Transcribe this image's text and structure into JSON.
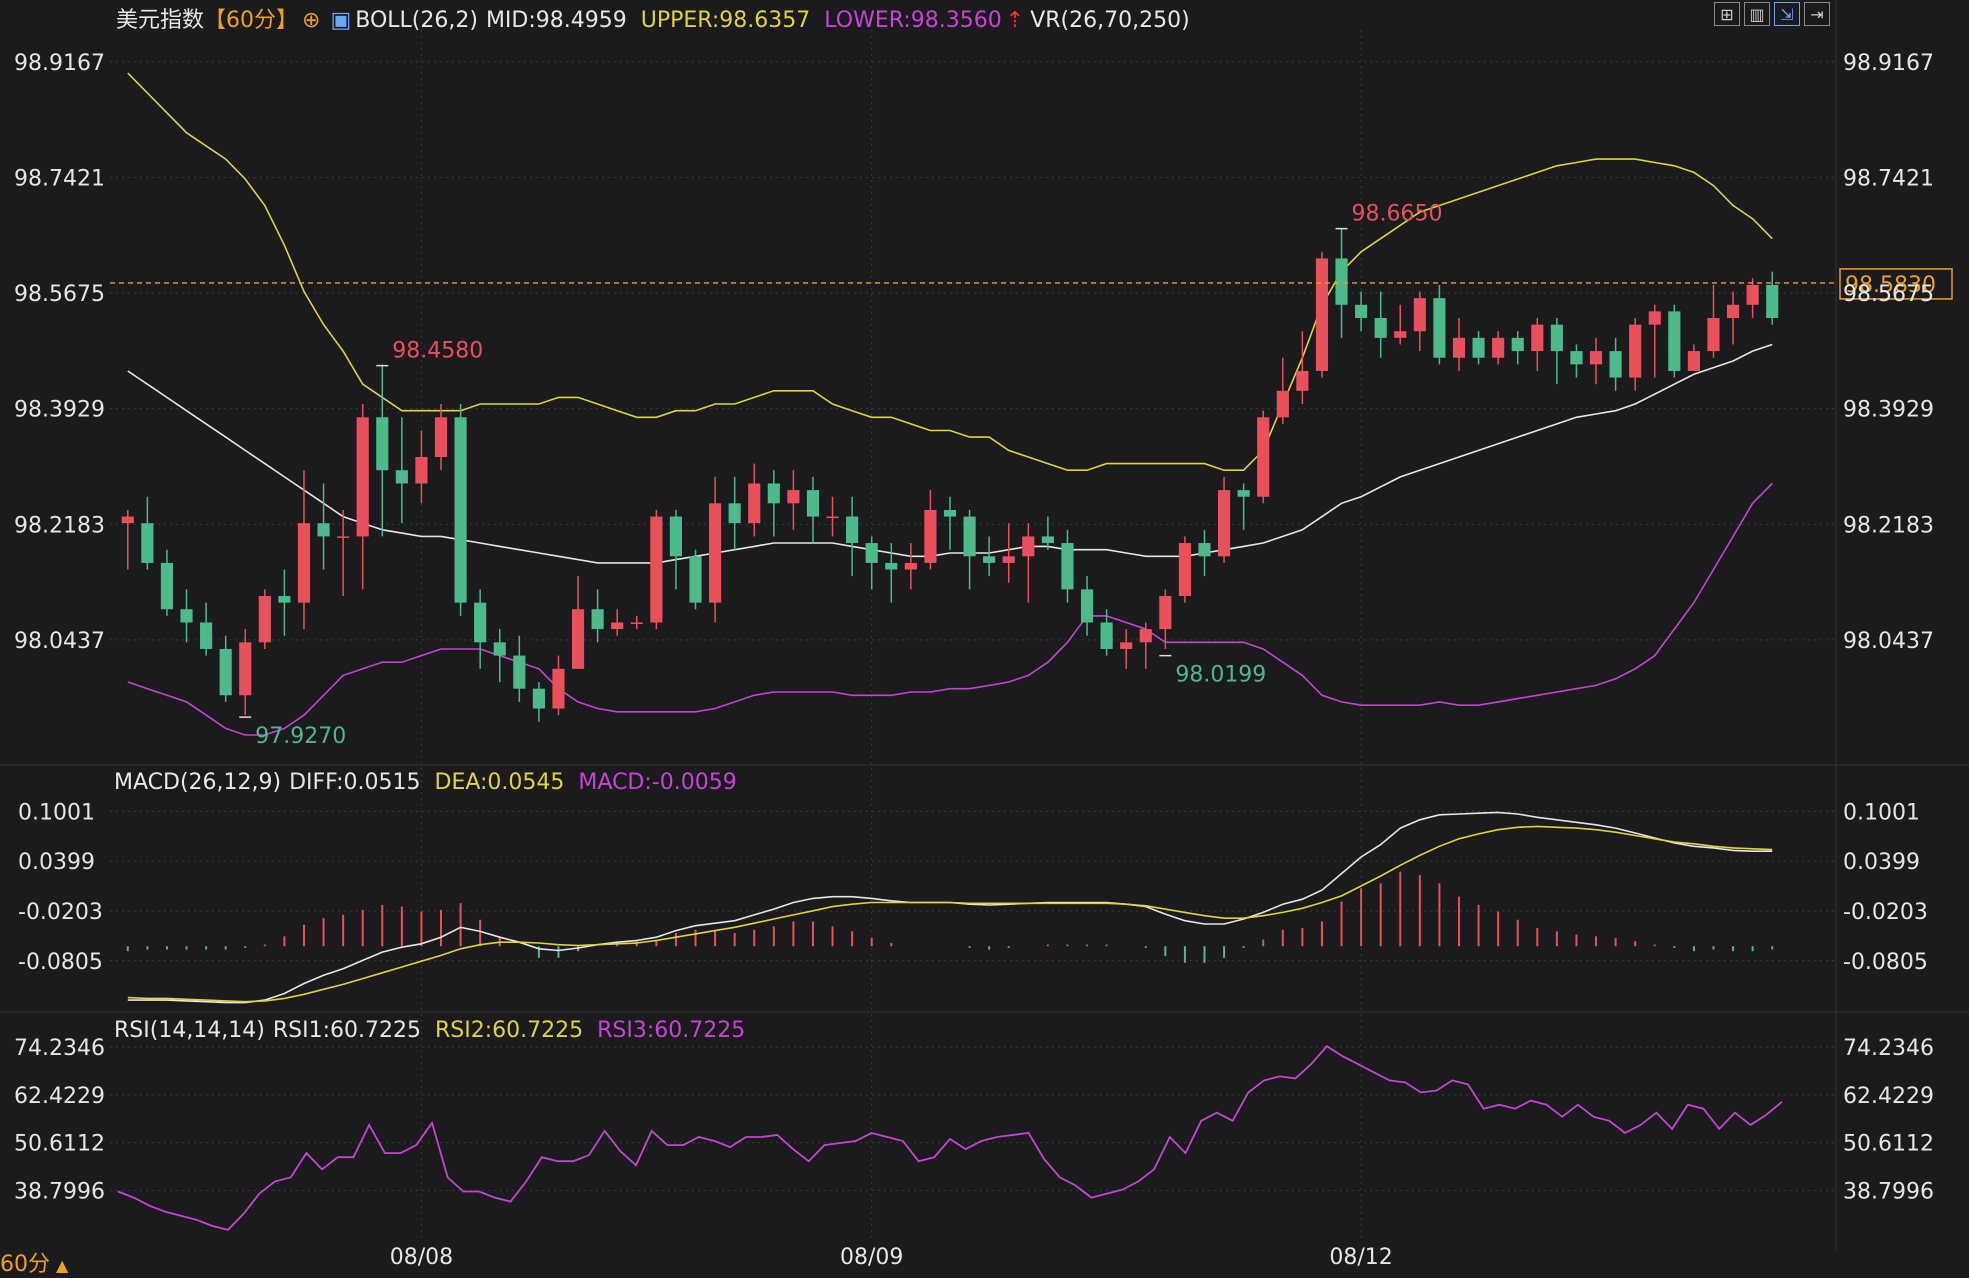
{
  "header": {
    "symbol": "美元指数",
    "period_tag": "【60分】",
    "boll_label": "BOLL(26,2)",
    "mid": "MID:98.4959",
    "upper": "UPPER:98.6357",
    "lower": "LOWER:98.3560",
    "vr_label": "VR(26,70,250)"
  },
  "macd_header": {
    "label": "MACD(26,12,9)",
    "diff": "DIFF:0.0515",
    "dea": "DEA:0.0545",
    "macd": "MACD:-0.0059"
  },
  "rsi_header": {
    "label": "RSI(14,14,14)",
    "rsi1": "RSI1:60.7225",
    "rsi2": "RSI2:60.7225",
    "rsi3": "RSI3:60.7225"
  },
  "period_footer": "60分",
  "colors": {
    "bg": "#1b1b1d",
    "up": "#e8515c",
    "down": "#4eb98a",
    "upper": "#e0d43a",
    "lower": "#c843d6",
    "mid": "#e6e6e6",
    "accent": "#f0a020",
    "grid": "#3a3a3a"
  },
  "chart_data": {
    "type": "candlestick",
    "price_axis_ticks": [
      98.9167,
      98.7421,
      98.5675,
      98.3929,
      98.2183,
      98.0437
    ],
    "price_axis_labels": [
      "98.9167",
      "98.7421",
      "98.5675",
      "98.3929",
      "98.2183",
      "98.0437"
    ],
    "ylim": [
      97.9,
      98.95
    ],
    "last_price": "98.5830",
    "last_price_value": 98.583,
    "high_annotations": [
      {
        "label": "98.4580",
        "value": 98.458,
        "index": 13
      },
      {
        "label": "98.6650",
        "value": 98.665,
        "index": 62
      }
    ],
    "low_annotations": [
      {
        "label": "97.9270",
        "value": 97.927,
        "index": 6
      },
      {
        "label": "98.0199",
        "value": 98.0199,
        "index": 53
      }
    ],
    "date_labels": [
      {
        "label": "08/08",
        "index": 15
      },
      {
        "label": "08/09",
        "index": 38
      },
      {
        "label": "08/12",
        "index": 63
      }
    ],
    "candles": [
      [
        98.22,
        98.23,
        98.15,
        98.24
      ],
      [
        98.22,
        98.16,
        98.15,
        98.26
      ],
      [
        98.16,
        98.09,
        98.08,
        98.18
      ],
      [
        98.09,
        98.07,
        98.04,
        98.12
      ],
      [
        98.07,
        98.03,
        98.02,
        98.1
      ],
      [
        98.03,
        97.96,
        97.95,
        98.05
      ],
      [
        97.96,
        98.04,
        97.93,
        98.06
      ],
      [
        98.04,
        98.11,
        98.03,
        98.12
      ],
      [
        98.11,
        98.1,
        98.05,
        98.15
      ],
      [
        98.1,
        98.22,
        98.06,
        98.3
      ],
      [
        98.22,
        98.2,
        98.15,
        98.28
      ],
      [
        98.2,
        98.2,
        98.11,
        98.24
      ],
      [
        98.2,
        98.38,
        98.12,
        98.4
      ],
      [
        98.38,
        98.3,
        98.2,
        98.46
      ],
      [
        98.3,
        98.28,
        98.22,
        98.38
      ],
      [
        98.28,
        98.32,
        98.25,
        98.36
      ],
      [
        98.32,
        98.38,
        98.3,
        98.4
      ],
      [
        98.38,
        98.1,
        98.08,
        98.4
      ],
      [
        98.1,
        98.04,
        98.0,
        98.12
      ],
      [
        98.04,
        98.02,
        97.98,
        98.06
      ],
      [
        98.02,
        97.97,
        97.95,
        98.05
      ],
      [
        97.97,
        97.94,
        97.92,
        97.98
      ],
      [
        97.94,
        98.0,
        97.93,
        98.02
      ],
      [
        98.0,
        98.09,
        98.0,
        98.14
      ],
      [
        98.09,
        98.06,
        98.04,
        98.12
      ],
      [
        98.06,
        98.07,
        98.05,
        98.09
      ],
      [
        98.07,
        98.07,
        98.06,
        98.08
      ],
      [
        98.07,
        98.23,
        98.06,
        98.24
      ],
      [
        98.23,
        98.17,
        98.12,
        98.24
      ],
      [
        98.17,
        98.1,
        98.09,
        98.18
      ],
      [
        98.1,
        98.25,
        98.07,
        98.29
      ],
      [
        98.25,
        98.22,
        98.18,
        98.29
      ],
      [
        98.22,
        98.28,
        98.2,
        98.31
      ],
      [
        98.28,
        98.25,
        98.2,
        98.3
      ],
      [
        98.25,
        98.27,
        98.21,
        98.3
      ],
      [
        98.27,
        98.23,
        98.19,
        98.29
      ],
      [
        98.23,
        98.23,
        98.2,
        98.26
      ],
      [
        98.23,
        98.19,
        98.14,
        98.26
      ],
      [
        98.19,
        98.16,
        98.12,
        98.2
      ],
      [
        98.16,
        98.15,
        98.1,
        98.19
      ],
      [
        98.15,
        98.16,
        98.12,
        98.19
      ],
      [
        98.16,
        98.24,
        98.15,
        98.27
      ],
      [
        98.24,
        98.23,
        98.18,
        98.26
      ],
      [
        98.23,
        98.17,
        98.12,
        98.24
      ],
      [
        98.17,
        98.16,
        98.14,
        98.2
      ],
      [
        98.16,
        98.17,
        98.13,
        98.22
      ],
      [
        98.17,
        98.2,
        98.1,
        98.22
      ],
      [
        98.2,
        98.19,
        98.18,
        98.23
      ],
      [
        98.19,
        98.12,
        98.1,
        98.21
      ],
      [
        98.12,
        98.07,
        98.05,
        98.14
      ],
      [
        98.07,
        98.03,
        98.02,
        98.09
      ],
      [
        98.03,
        98.04,
        98.0,
        98.06
      ],
      [
        98.04,
        98.06,
        98.0,
        98.07
      ],
      [
        98.06,
        98.11,
        98.03,
        98.12
      ],
      [
        98.11,
        98.19,
        98.1,
        98.2
      ],
      [
        98.19,
        98.17,
        98.14,
        98.21
      ],
      [
        98.17,
        98.27,
        98.16,
        98.29
      ],
      [
        98.27,
        98.26,
        98.21,
        98.28
      ],
      [
        98.26,
        98.38,
        98.25,
        98.39
      ],
      [
        98.38,
        98.42,
        98.37,
        98.47
      ],
      [
        98.42,
        98.45,
        98.4,
        98.51
      ],
      [
        98.45,
        98.62,
        98.44,
        98.63
      ],
      [
        98.62,
        98.55,
        98.5,
        98.665
      ],
      [
        98.55,
        98.53,
        98.51,
        98.57
      ],
      [
        98.53,
        98.5,
        98.47,
        98.57
      ],
      [
        98.5,
        98.51,
        98.49,
        98.55
      ],
      [
        98.51,
        98.56,
        98.48,
        98.57
      ],
      [
        98.56,
        98.47,
        98.46,
        98.58
      ],
      [
        98.47,
        98.5,
        98.45,
        98.53
      ],
      [
        98.5,
        98.47,
        98.46,
        98.51
      ],
      [
        98.47,
        98.5,
        98.46,
        98.51
      ],
      [
        98.5,
        98.48,
        98.46,
        98.51
      ],
      [
        98.48,
        98.52,
        98.45,
        98.53
      ],
      [
        98.52,
        98.48,
        98.43,
        98.53
      ],
      [
        98.48,
        98.46,
        98.44,
        98.49
      ],
      [
        98.46,
        98.48,
        98.43,
        98.5
      ],
      [
        98.48,
        98.44,
        98.42,
        98.5
      ],
      [
        98.44,
        98.52,
        98.42,
        98.53
      ],
      [
        98.52,
        98.54,
        98.44,
        98.55
      ],
      [
        98.54,
        98.45,
        98.44,
        98.55
      ],
      [
        98.45,
        98.48,
        98.45,
        98.49
      ],
      [
        98.48,
        98.53,
        98.47,
        98.58
      ],
      [
        98.53,
        98.55,
        98.49,
        98.57
      ],
      [
        98.55,
        98.58,
        98.53,
        98.59
      ],
      [
        98.58,
        98.53,
        98.52,
        98.6
      ]
    ],
    "boll_upper": [
      98.9,
      98.87,
      98.84,
      98.81,
      98.79,
      98.77,
      98.74,
      98.7,
      98.64,
      98.57,
      98.52,
      98.48,
      98.43,
      98.41,
      98.39,
      98.39,
      98.39,
      98.39,
      98.4,
      98.4,
      98.4,
      98.4,
      98.41,
      98.41,
      98.4,
      98.39,
      98.38,
      98.38,
      98.39,
      98.39,
      98.4,
      98.4,
      98.41,
      98.42,
      98.42,
      98.42,
      98.4,
      98.39,
      98.38,
      98.38,
      98.37,
      98.36,
      98.36,
      98.35,
      98.35,
      98.33,
      98.32,
      98.31,
      98.3,
      98.3,
      98.31,
      98.31,
      98.31,
      98.31,
      98.31,
      98.31,
      98.3,
      98.3,
      98.33,
      98.4,
      98.47,
      98.55,
      98.6,
      98.63,
      98.65,
      98.67,
      98.69,
      98.7,
      98.71,
      98.72,
      98.73,
      98.74,
      98.75,
      98.76,
      98.765,
      98.77,
      98.77,
      98.77,
      98.765,
      98.76,
      98.75,
      98.73,
      98.7,
      98.68,
      98.65
    ],
    "boll_mid": [
      98.45,
      98.43,
      98.41,
      98.39,
      98.37,
      98.35,
      98.33,
      98.31,
      98.29,
      98.27,
      98.25,
      98.23,
      98.22,
      98.21,
      98.205,
      98.2,
      98.2,
      98.195,
      98.19,
      98.185,
      98.18,
      98.175,
      98.17,
      98.165,
      98.16,
      98.16,
      98.16,
      98.16,
      98.165,
      98.17,
      98.175,
      98.18,
      98.185,
      98.19,
      98.19,
      98.19,
      98.19,
      98.185,
      98.18,
      98.175,
      98.17,
      98.17,
      98.175,
      98.175,
      98.175,
      98.18,
      98.185,
      98.185,
      98.18,
      98.18,
      98.18,
      98.175,
      98.17,
      98.17,
      98.17,
      98.175,
      98.18,
      98.185,
      98.19,
      98.2,
      98.21,
      98.23,
      98.25,
      98.26,
      98.275,
      98.29,
      98.3,
      98.31,
      98.32,
      98.33,
      98.34,
      98.35,
      98.36,
      98.37,
      98.38,
      98.385,
      98.39,
      98.4,
      98.415,
      98.43,
      98.445,
      98.455,
      98.465,
      98.48,
      98.49
    ],
    "boll_lower": [
      97.98,
      97.97,
      97.96,
      97.95,
      97.93,
      97.91,
      97.9,
      97.9,
      97.91,
      97.93,
      97.96,
      97.99,
      98.0,
      98.01,
      98.01,
      98.02,
      98.03,
      98.03,
      98.03,
      98.02,
      98.01,
      98.0,
      97.97,
      97.95,
      97.94,
      97.935,
      97.935,
      97.935,
      97.935,
      97.935,
      97.94,
      97.95,
      97.96,
      97.965,
      97.965,
      97.965,
      97.965,
      97.96,
      97.96,
      97.96,
      97.965,
      97.965,
      97.97,
      97.97,
      97.975,
      97.98,
      97.99,
      98.01,
      98.04,
      98.08,
      98.08,
      98.07,
      98.06,
      98.04,
      98.04,
      98.04,
      98.04,
      98.04,
      98.03,
      98.01,
      97.99,
      97.96,
      97.95,
      97.945,
      97.945,
      97.945,
      97.945,
      97.95,
      97.945,
      97.945,
      97.95,
      97.955,
      97.96,
      97.965,
      97.97,
      97.975,
      97.985,
      98.0,
      98.02,
      98.06,
      98.1,
      98.15,
      98.2,
      98.25,
      98.28
    ],
    "macd_axis_ticks": [
      0.1001,
      0.0399,
      -0.0203,
      -0.0805
    ],
    "macd_axis_labels": [
      "0.1001",
      "0.0399",
      "-0.0203",
      "-0.0805"
    ],
    "macd_ylim": [
      -0.14,
      0.12
    ],
    "diff": [
      -0.128,
      -0.128,
      -0.128,
      -0.129,
      -0.13,
      -0.131,
      -0.131,
      -0.128,
      -0.12,
      -0.108,
      -0.098,
      -0.09,
      -0.08,
      -0.07,
      -0.064,
      -0.06,
      -0.052,
      -0.04,
      -0.045,
      -0.052,
      -0.058,
      -0.066,
      -0.068,
      -0.065,
      -0.061,
      -0.058,
      -0.056,
      -0.052,
      -0.044,
      -0.038,
      -0.035,
      -0.032,
      -0.025,
      -0.018,
      -0.01,
      -0.005,
      -0.003,
      -0.003,
      -0.005,
      -0.008,
      -0.01,
      -0.01,
      -0.01,
      -0.012,
      -0.013,
      -0.012,
      -0.011,
      -0.01,
      -0.01,
      -0.01,
      -0.01,
      -0.012,
      -0.015,
      -0.024,
      -0.032,
      -0.036,
      -0.036,
      -0.03,
      -0.022,
      -0.012,
      -0.006,
      0.005,
      0.025,
      0.045,
      0.06,
      0.08,
      0.09,
      0.096,
      0.097,
      0.098,
      0.099,
      0.097,
      0.093,
      0.09,
      0.087,
      0.084,
      0.08,
      0.074,
      0.068,
      0.062,
      0.058,
      0.056,
      0.053,
      0.052,
      0.052
    ],
    "dea": [
      -0.125,
      -0.126,
      -0.126,
      -0.127,
      -0.128,
      -0.129,
      -0.13,
      -0.129,
      -0.126,
      -0.121,
      -0.115,
      -0.109,
      -0.102,
      -0.095,
      -0.088,
      -0.081,
      -0.074,
      -0.066,
      -0.061,
      -0.058,
      -0.058,
      -0.059,
      -0.061,
      -0.062,
      -0.061,
      -0.06,
      -0.059,
      -0.056,
      -0.052,
      -0.048,
      -0.044,
      -0.04,
      -0.035,
      -0.03,
      -0.025,
      -0.02,
      -0.015,
      -0.012,
      -0.01,
      -0.01,
      -0.01,
      -0.01,
      -0.01,
      -0.011,
      -0.011,
      -0.011,
      -0.011,
      -0.011,
      -0.011,
      -0.011,
      -0.011,
      -0.012,
      -0.014,
      -0.018,
      -0.022,
      -0.026,
      -0.029,
      -0.029,
      -0.026,
      -0.022,
      -0.017,
      -0.01,
      -0.002,
      0.01,
      0.022,
      0.035,
      0.047,
      0.058,
      0.067,
      0.073,
      0.078,
      0.081,
      0.082,
      0.081,
      0.08,
      0.078,
      0.075,
      0.071,
      0.067,
      0.063,
      0.061,
      0.058,
      0.056,
      0.055,
      0.054
    ]
  },
  "rsi_axis_labels": [
    "74.2346",
    "62.4229",
    "50.6112",
    "38.7996"
  ],
  "rsi_axis_ticks": [
    74.2346,
    62.4229,
    50.6112,
    38.7996
  ],
  "rsi_ylim": [
    27,
    76
  ],
  "rsi": [
    38.5,
    37.0,
    35.0,
    33.5,
    32.5,
    31.5,
    30.0,
    29.0,
    33.0,
    38.0,
    41.0,
    42.0,
    48.0,
    44.0,
    47.0,
    47.0,
    55.0,
    48.0,
    48.0,
    50.0,
    55.5,
    42.0,
    38.5,
    38.5,
    37.0,
    36.0,
    41.0,
    47.0,
    46.0,
    46.0,
    47.5,
    53.5,
    48.5,
    45.0,
    53.5,
    50.0,
    50.0,
    52.0,
    51.0,
    49.5,
    52.0,
    52.0,
    52.5,
    49.0,
    46.0,
    50.0,
    50.5,
    51.0,
    53.0,
    52.0,
    51.0,
    46.0,
    47.0,
    51.5,
    49.0,
    51.0,
    52.0,
    52.5,
    53.0,
    46.5,
    42.0,
    40.0,
    37.0,
    38.0,
    39.0,
    41.0,
    44.0,
    52.0,
    48.0,
    56.0,
    58.0,
    56.0,
    63.0,
    66.0,
    67.0,
    66.5,
    70.0,
    74.5,
    72.0,
    70.0,
    68.0,
    66.0,
    65.5,
    63.0,
    63.5,
    66.0,
    65.0,
    59.0,
    60.0,
    59.0,
    61.0,
    60.0,
    57.0,
    60.0,
    57.0,
    56.0,
    53.0,
    55.0,
    58.0,
    54.0,
    60.0,
    59.0,
    54.0,
    58.0,
    55.0,
    57.5,
    60.7
  ]
}
